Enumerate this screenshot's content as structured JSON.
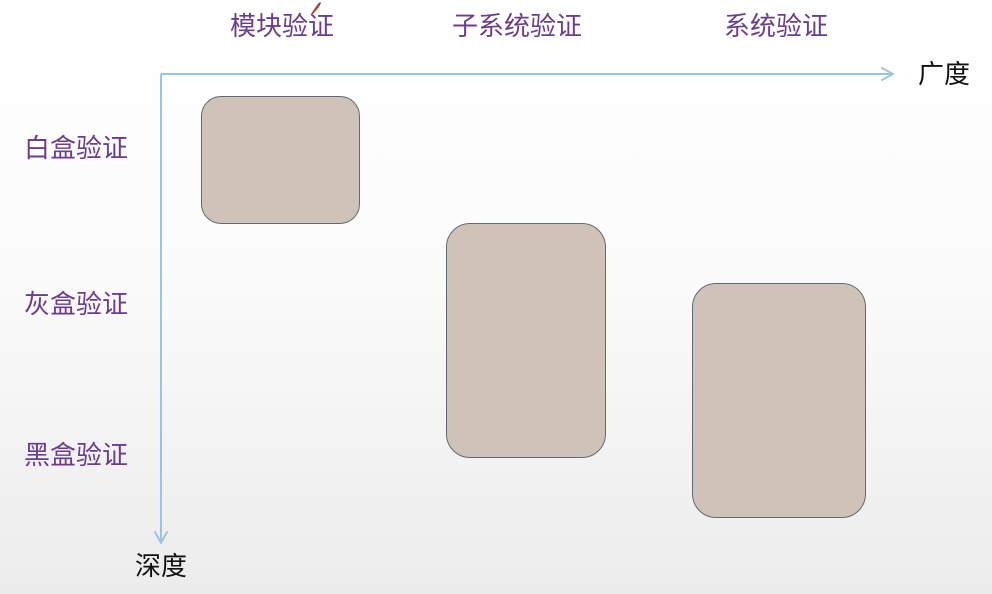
{
  "axes": {
    "x_label": "广度",
    "y_label": "深度",
    "color": "#9cc3df"
  },
  "columns": [
    "模块验证",
    "子系统验证",
    "系统验证"
  ],
  "rows": [
    "白盒验证",
    "灰盒验证",
    "黑盒验证"
  ],
  "blocks": [
    {
      "name": "模块验证-白盒验证",
      "fill": "#cfc3b8"
    },
    {
      "name": "子系统验证-灰盒与黑盒验证",
      "fill": "#cfc3b8"
    },
    {
      "name": "系统验证-灰盒与黑盒验证",
      "fill": "#cfc3b8"
    }
  ],
  "colors": {
    "header_text": "#6b3d8c",
    "axis_text": "#111111",
    "block_fill": "#cfc3b8",
    "block_border": "#5f6b73"
  }
}
